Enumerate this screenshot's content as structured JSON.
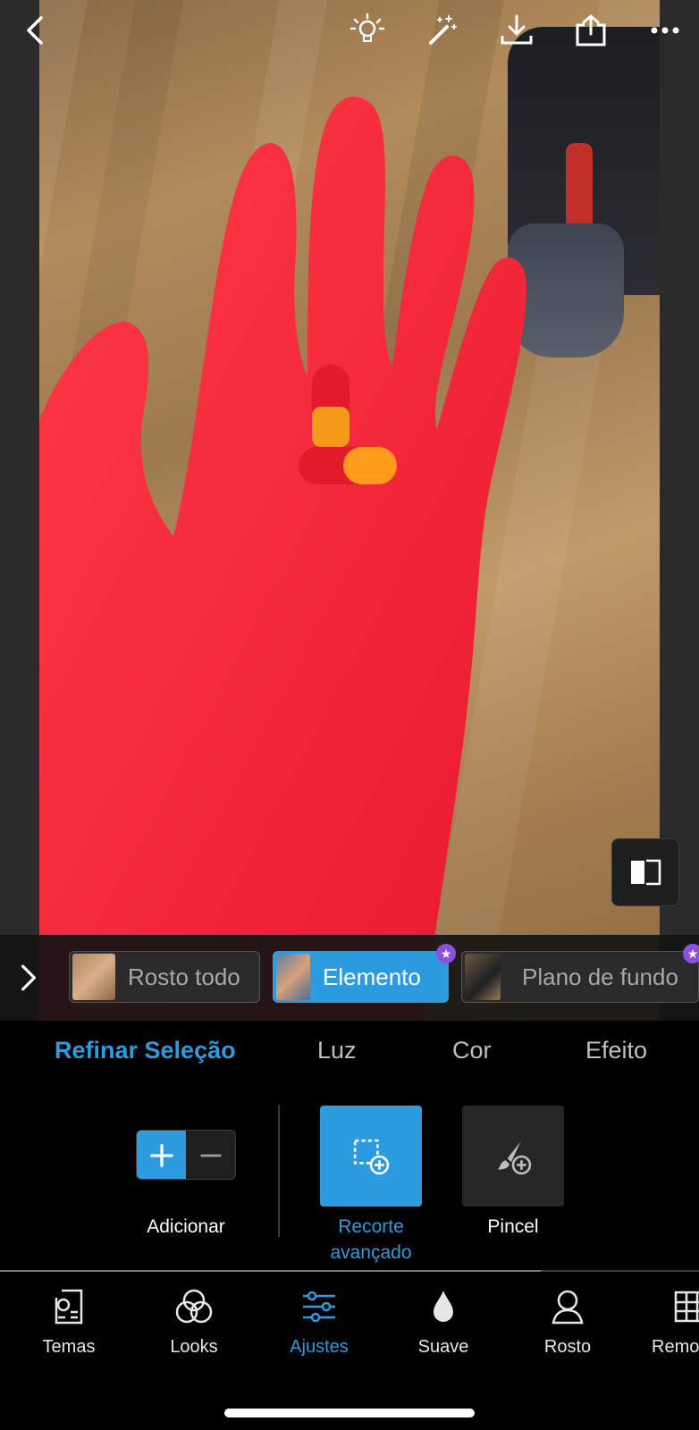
{
  "selection_chips": [
    {
      "label": "Rosto todo",
      "active": false,
      "premium": false
    },
    {
      "label": "Elemento",
      "active": true,
      "premium": true
    },
    {
      "label": "Plano de fundo",
      "active": false,
      "premium": true
    }
  ],
  "adjust_tabs": [
    {
      "label": "Refinar Seleção",
      "active": true
    },
    {
      "label": "Luz",
      "active": false
    },
    {
      "label": "Cor",
      "active": false
    },
    {
      "label": "Efeito",
      "active": false
    }
  ],
  "tools": {
    "add_label": "Adicionar",
    "recorte_label": "Recorte avançado",
    "pincel_label": "Pincel"
  },
  "bottom_nav": [
    {
      "label": "Temas",
      "icon": "themes-icon",
      "active": false
    },
    {
      "label": "Looks",
      "icon": "looks-icon",
      "active": false
    },
    {
      "label": "Ajustes",
      "icon": "sliders-icon",
      "active": true
    },
    {
      "label": "Suave",
      "icon": "drop-icon",
      "active": false
    },
    {
      "label": "Rosto",
      "icon": "face-icon",
      "active": false
    },
    {
      "label": "Remo",
      "icon": "grid-icon",
      "active": false
    }
  ],
  "colors": {
    "accent": "#2d9be0",
    "premium": "#8d4fe0",
    "mask": "#ff2a3c"
  }
}
